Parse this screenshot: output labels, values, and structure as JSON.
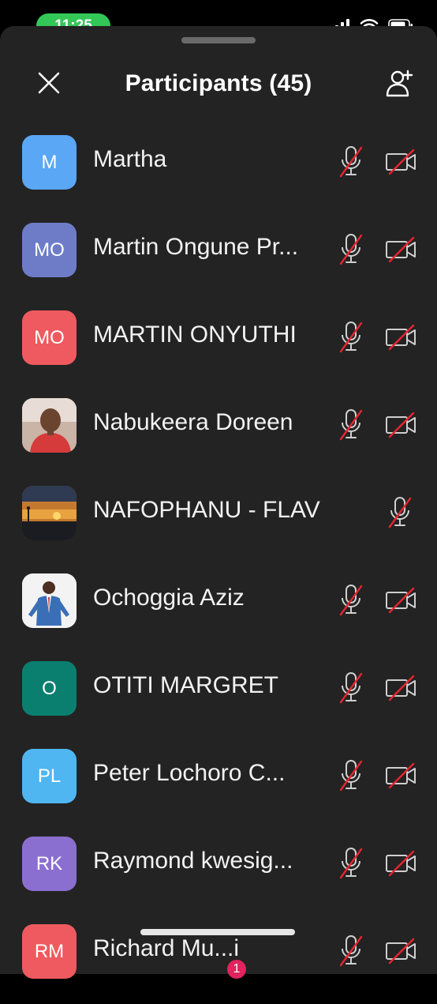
{
  "status_bar": {
    "time": "11:25"
  },
  "header": {
    "title": "Participants (45)"
  },
  "participants": [
    {
      "initials": "M",
      "name": "Martha",
      "color": "#5aa7f5",
      "avatar_type": "initials",
      "show_video_icon": true
    },
    {
      "initials": "MO",
      "name": "Martin Ongune Pr...",
      "color": "#6e7cc8",
      "avatar_type": "initials",
      "show_video_icon": true
    },
    {
      "initials": "MO",
      "name": "MARTIN ONYUTHI",
      "color": "#ee5a5f",
      "avatar_type": "initials",
      "show_video_icon": true
    },
    {
      "initials": "",
      "name": "Nabukeera Doreen",
      "color": "#b9967f",
      "avatar_type": "photo-person",
      "show_video_icon": true
    },
    {
      "initials": "",
      "name": "NAFOPHANU - FLAVIA",
      "color": "#c47a2e",
      "avatar_type": "photo-sunset",
      "show_video_icon": false
    },
    {
      "initials": "",
      "name": "Ochoggia Aziz",
      "color": "#f3f3f3",
      "avatar_type": "photo-suit",
      "show_video_icon": true
    },
    {
      "initials": "O",
      "name": "OTITI MARGRET",
      "color": "#0a7f70",
      "avatar_type": "initials",
      "show_video_icon": true
    },
    {
      "initials": "PL",
      "name": "Peter Lochoro C...",
      "color": "#4fb6f2",
      "avatar_type": "initials",
      "show_video_icon": true
    },
    {
      "initials": "RK",
      "name": "Raymond kwesig...",
      "color": "#8b6fd0",
      "avatar_type": "initials",
      "show_video_icon": true
    },
    {
      "initials": "RM",
      "name": "Richard Mu...i",
      "color": "#ee5a5f",
      "avatar_type": "initials",
      "show_video_icon": true
    }
  ],
  "badge": {
    "count": "1"
  },
  "colors": {
    "sheet": "#232323",
    "mute_slash": "#e5252f",
    "status_green": "#33c758"
  }
}
